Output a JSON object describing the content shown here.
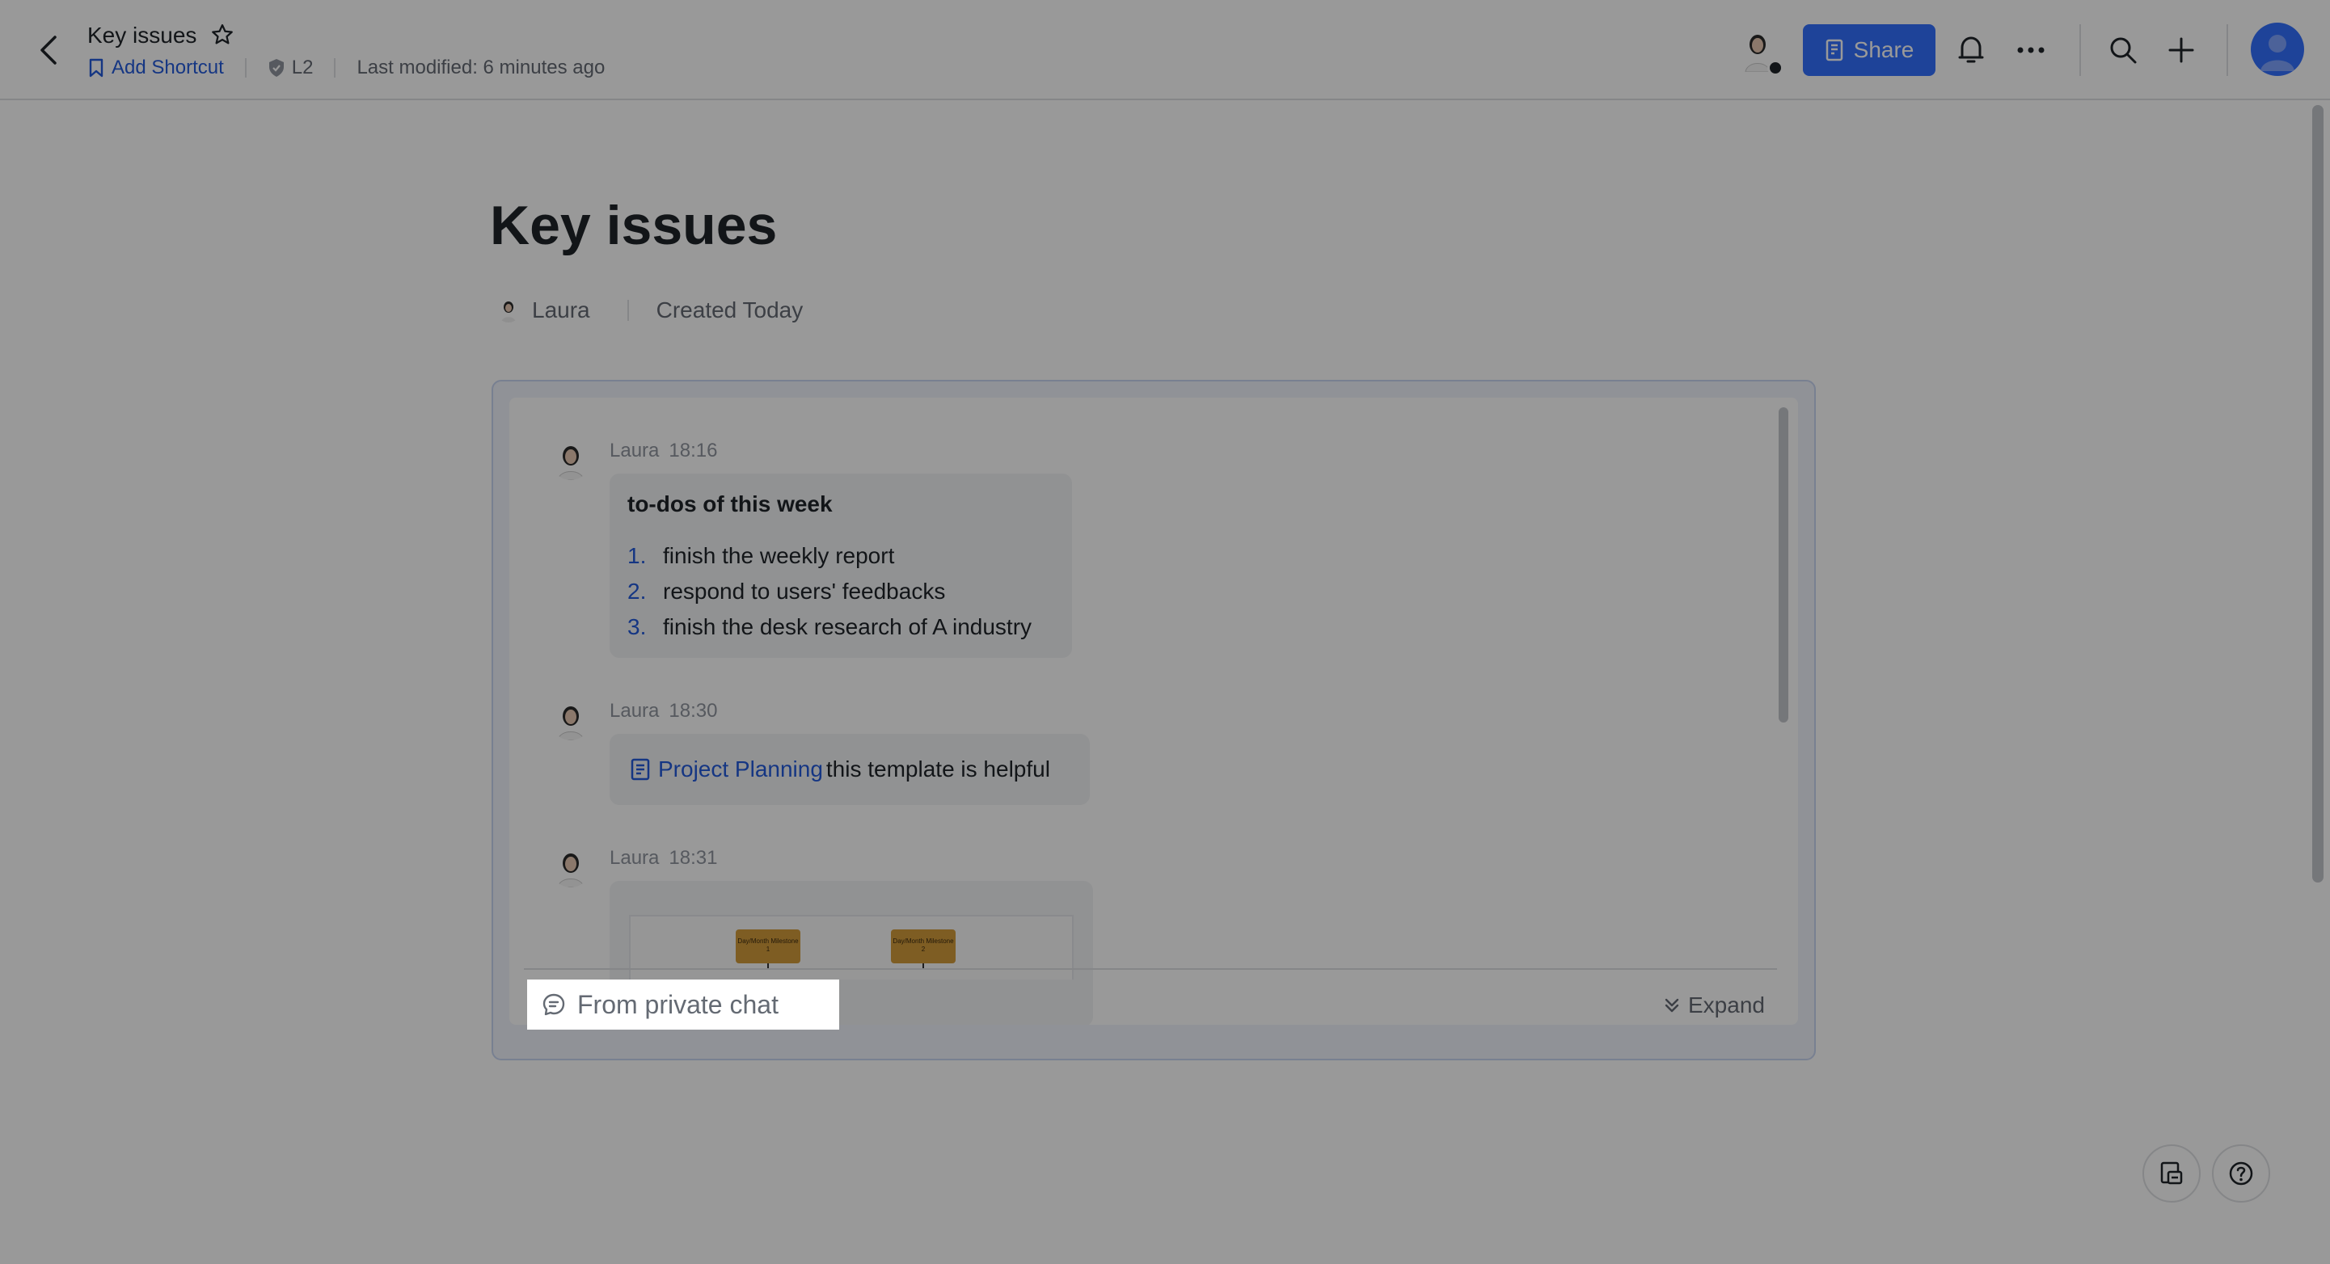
{
  "header": {
    "doc_title": "Key issues",
    "add_shortcut": "Add Shortcut",
    "security_level": "L2",
    "last_modified": "Last modified: 6 minutes ago",
    "share_label": "Share"
  },
  "page": {
    "title": "Key issues",
    "author": "Laura",
    "created": "Created Today"
  },
  "messages": [
    {
      "sender": "Laura",
      "time": "18:16",
      "title": "to-dos of this week",
      "todos": [
        {
          "num": "1.",
          "text": "finish the weekly report"
        },
        {
          "num": "2.",
          "text": "respond to users' feedbacks"
        },
        {
          "num": "3.",
          "text": "finish the desk research of A industry"
        }
      ]
    },
    {
      "sender": "Laura",
      "time": "18:30",
      "link_text": "Project Planning",
      "rest_text": "this template is helpful"
    },
    {
      "sender": "Laura",
      "time": "18:31",
      "milestones": [
        "Day/Month Milestone 1",
        "Day/Month Milestone 2"
      ]
    }
  ],
  "card_footer": {
    "source": "From private chat",
    "expand": "Expand"
  },
  "colors": {
    "accent": "#3370ff",
    "link": "#245bdb",
    "overlay": "rgba(0,0,0,0.4)"
  }
}
